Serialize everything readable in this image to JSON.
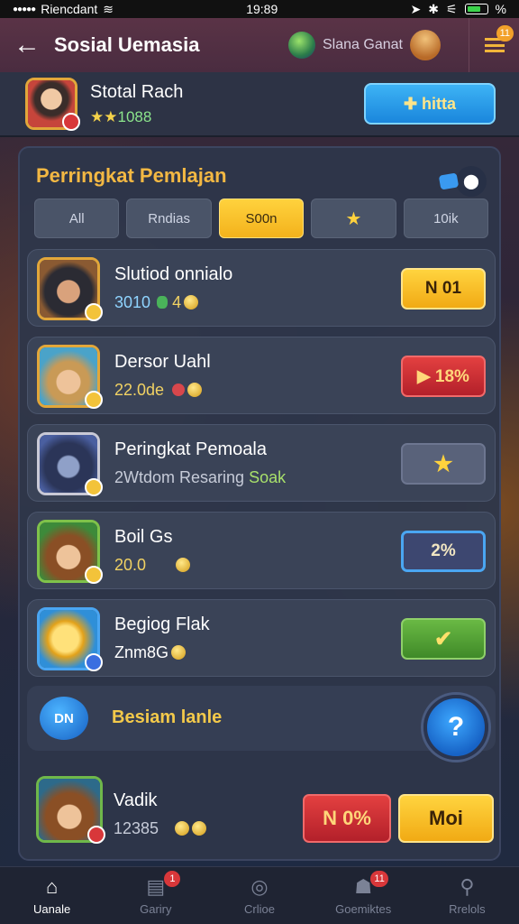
{
  "status_bar": {
    "carrier": "Riencdant",
    "time": "19:89",
    "battery": "%"
  },
  "header": {
    "title": "Sosial Uemasia",
    "subtitle": "Slana Ganat",
    "menu_badge": "11"
  },
  "profile": {
    "name": "Stotal Rach",
    "score": "1088",
    "button": "hitta"
  },
  "panel": {
    "title": "Perringkat Pemlajan",
    "tabs": [
      {
        "label": "All"
      },
      {
        "label": "Rndias"
      },
      {
        "label": "S00n"
      },
      {
        "label": "★"
      },
      {
        "label": "10ik"
      }
    ]
  },
  "rows": [
    {
      "name": "Slutiod onnialo",
      "sub_a": "3010",
      "sub_b": "4",
      "button": "N 01"
    },
    {
      "name": "Dersor Uahl",
      "sub_a": "22.0de",
      "button": "▶ 18%"
    },
    {
      "name": "Peringkat Pemoala",
      "sub_a": "2Wtdom Resaring",
      "sub_b": "Soak",
      "button": "★"
    },
    {
      "name": "Boil Gs",
      "sub_a": "20.0",
      "button": "2%"
    },
    {
      "name": "Begiog Flak",
      "sub_a": "Znm8G",
      "button": "✔"
    }
  ],
  "banner": {
    "icon_label": "DN",
    "text": "Besiam lanle"
  },
  "last_row": {
    "name": "Vadik",
    "score": "12385",
    "button_red": "N 0%",
    "button_yellow": "Moi"
  },
  "nav": [
    {
      "label": "Uanale",
      "badge": ""
    },
    {
      "label": "Gariry",
      "badge": "1"
    },
    {
      "label": "Crlioe",
      "badge": ""
    },
    {
      "label": "Goemiktes",
      "badge": "11"
    },
    {
      "label": "Rrelols",
      "badge": ""
    }
  ],
  "colors": {
    "accent": "#f3b843",
    "primary_blue": "#1a86dc",
    "header": "#5a3346"
  }
}
